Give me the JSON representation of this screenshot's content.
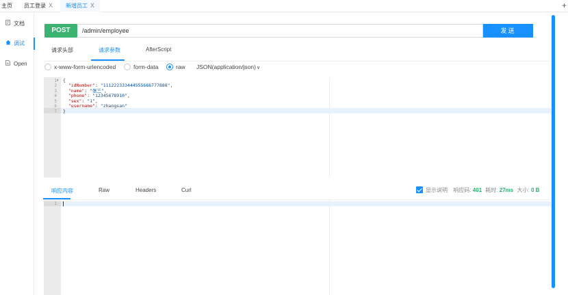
{
  "tabs": [
    {
      "label": "主页",
      "closable": false,
      "active": false
    },
    {
      "label": "员工登录",
      "closable": true,
      "active": false
    },
    {
      "label": "新增员工",
      "closable": true,
      "active": true
    }
  ],
  "tab_close_glyph": "X",
  "new_tab_glyph": "+",
  "sidebar": {
    "items": [
      {
        "label": "文档",
        "icon": "doc-icon",
        "active": false
      },
      {
        "label": "调试",
        "icon": "home-icon",
        "active": true
      },
      {
        "label": "Open",
        "icon": "file-icon",
        "active": false
      }
    ]
  },
  "request": {
    "method": "POST",
    "url": "/admin/employee",
    "send_label": "发送"
  },
  "request_tabs": [
    "请求头部",
    "请求参数",
    "AfterScript"
  ],
  "request_tabs_active": 1,
  "body_types": [
    {
      "label": "x-www-form-urlencoded",
      "checked": false
    },
    {
      "label": "form-data",
      "checked": false
    },
    {
      "label": "raw",
      "checked": true
    }
  ],
  "raw_format": "JSON(application/json)",
  "raw_format_chevron": "∨",
  "body_code": {
    "line_numbers": [
      "1",
      "2",
      "3",
      "4",
      "5",
      "6",
      "7"
    ],
    "fold_marker": "▾",
    "lines": [
      "{",
      "  \"idNumber\": \"111222333444555666777888\",",
      "  \"name\": \"张三\",",
      "  \"phone\": \"12345678910\",",
      "  \"sex\": \"1\",",
      "  \"username\": \"zhangsan\"",
      "}"
    ],
    "highlight_line": 6
  },
  "response_tabs": [
    "响应内容",
    "Raw",
    "Headers",
    "Curl"
  ],
  "response_tabs_active": 0,
  "response_status": {
    "show_desc_label": "显示说明",
    "show_desc_checked": true,
    "code_label": "响应码:",
    "code": "401",
    "time_label": "耗时:",
    "time": "27ms",
    "size_label": "大小:",
    "size": "0 B"
  },
  "response_code": {
    "line_numbers": [
      "1"
    ]
  },
  "colors": {
    "accent": "#1890ff",
    "method_post": "#3cb371",
    "status_green": "#21b36b"
  }
}
